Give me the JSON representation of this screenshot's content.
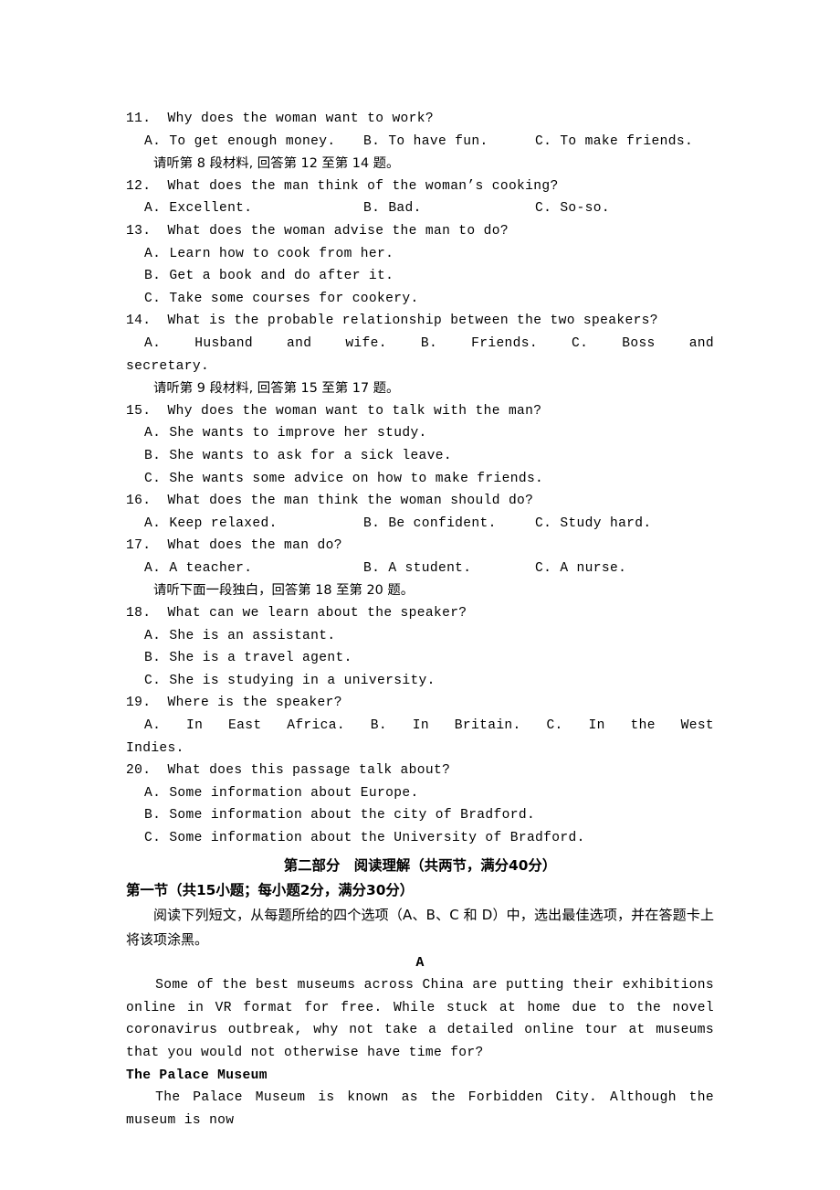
{
  "document": {
    "type": "english-exam-paper",
    "visible_page_section": "listening-questions-11-to-20-and-reading-part-two"
  },
  "listening": {
    "questions": [
      {
        "number": "11.",
        "stem": "11.  Why does the woman want to work?",
        "layout": "row",
        "options_row": {
          "a": "A. To get enough money.",
          "b": "B. To have fun.",
          "c": "C. To make friends."
        }
      }
    ],
    "instruction_8": "请听第 8 段材料, 回答第 12 至第 14 题。",
    "q12": {
      "stem": "12.  What does the man think of the woman’s cooking?",
      "options_row": {
        "a": "A. Excellent.",
        "b": "B. Bad.",
        "c": "C. So-so."
      }
    },
    "q13": {
      "stem": "13.  What does the woman advise the man to do?",
      "options": [
        "A. Learn how to cook from her.",
        "B. Get a book and do after it.",
        "C. Take some courses for cookery."
      ]
    },
    "q14": {
      "stem": "14.  What is the probable relationship between the two speakers?",
      "option_a": "A. Husband and wife.",
      "option_b": "B. Friends.",
      "option_c_lead": "C.",
      "option_c_word1": "Boss",
      "option_c_word2": "and",
      "option_c_continuation": "secretary."
    },
    "instruction_9": "请听第 9 段材料, 回答第 15 至第 17 题。",
    "q15": {
      "stem": "15.  Why does the woman want to talk with the man?",
      "options": [
        "A. She wants to improve her study.",
        "B. She wants to ask for a sick leave.",
        "C. She wants some advice on how to make friends."
      ]
    },
    "q16": {
      "stem": "16.  What does the man think the woman should do?",
      "options_row": {
        "a": "A. Keep relaxed.",
        "b": "B. Be confident.",
        "c": "C. Study hard."
      }
    },
    "q17": {
      "stem": "17.  What does the man do?",
      "options_row": {
        "a": "A. A teacher.",
        "b": "B. A student.",
        "c": "C. A nurse."
      }
    },
    "instruction_monologue": "请听下面一段独白，回答第 18 至第 20 题。",
    "q18": {
      "stem": "18.  What can we learn about the speaker?",
      "options": [
        "A. She is an assistant.",
        "B. She is a travel agent.",
        "C. She is studying in a university."
      ]
    },
    "q19": {
      "stem": "19.  Where is the speaker?",
      "option_a": "A. In East Africa.",
      "option_b": "B. In Britain.",
      "option_c_lead": "C.",
      "option_c_word1": "In",
      "option_c_word2": "the",
      "option_c_word3": "West",
      "option_c_continuation": "Indies."
    },
    "q20": {
      "stem": "20.  What does this passage talk about?",
      "options": [
        "A. Some information about Europe.",
        "B. Some information about the city of Bradford.",
        "C. Some information about the University of Bradford."
      ]
    }
  },
  "reading": {
    "part_title": "第二部分　阅读理解（共两节，满分40分）",
    "section_one_title": "第一节（共15小题；每小题2分，满分30分）",
    "section_one_instruction": "阅读下列短文，从每题所给的四个选项（A、B、C 和 D）中，选出最佳选项，并在答题卡上将该项涂黑。",
    "passage_letter": "A",
    "passage_intro": "Some of the best museums across China are putting their exhibitions online in VR format for free. While stuck at home due to the novel coronavirus outbreak, why not take a detailed online tour at museums that you would not otherwise have time for?",
    "passage_sub_head": "The Palace Museum",
    "passage_sub_body": "The Palace Museum is known as the Forbidden City. Although the museum is now"
  }
}
